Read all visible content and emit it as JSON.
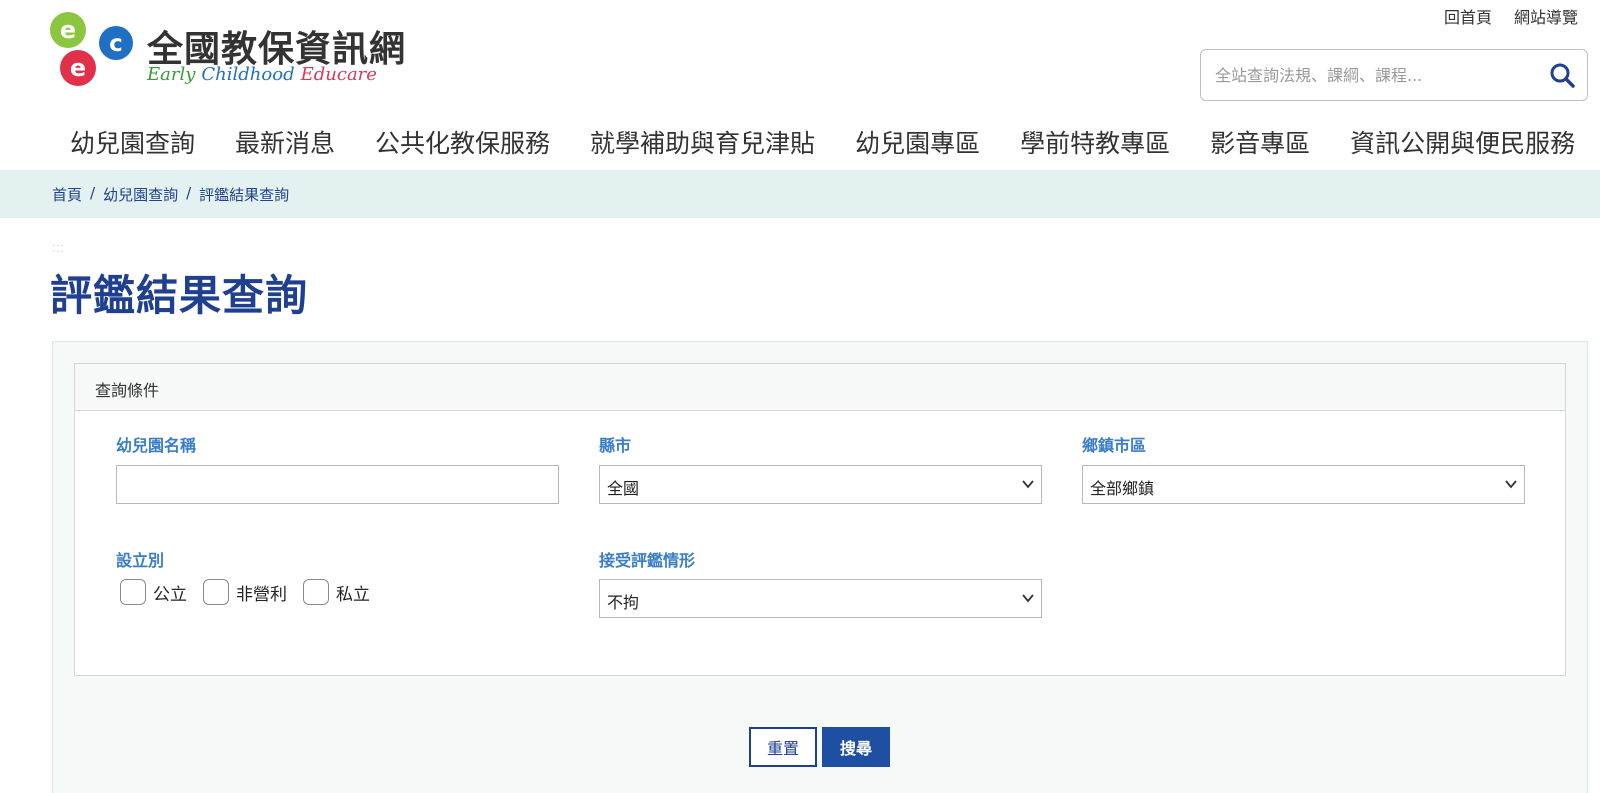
{
  "site": {
    "title": "全國教保資訊網",
    "subtitle_words": [
      "Early",
      "Childhood",
      "Educare"
    ]
  },
  "top_links": [
    "回首頁",
    "網站導覽"
  ],
  "search": {
    "placeholder": "全站查詢法規、課綱、課程..."
  },
  "main_nav": [
    "幼兒園查詢",
    "最新消息",
    "公共化教保服務",
    "就學補助與育兒津貼",
    "幼兒園專區",
    "學前特教專區",
    "影音專區",
    "資訊公開與便民服務"
  ],
  "breadcrumb": {
    "items": [
      "首頁",
      "幼兒園查詢",
      "評鑑結果查詢"
    ],
    "separator": "/"
  },
  "page_title": "評鑑結果查詢",
  "form": {
    "panel_title": "查詢條件",
    "kindergarten_name": {
      "label": "幼兒園名稱",
      "value": ""
    },
    "county": {
      "label": "縣市",
      "value": "全國"
    },
    "township": {
      "label": "鄉鎮市區",
      "value": "全部鄉鎮"
    },
    "establishment": {
      "label": "設立別",
      "options": [
        "公立",
        "非營利",
        "私立"
      ]
    },
    "evaluation_status": {
      "label": "接受評鑑情形",
      "value": "不拘"
    },
    "reset_label": "重置",
    "search_label": "搜尋"
  },
  "colors": {
    "brand_blue": "#1f3f8f",
    "label_blue": "#3a7ec8",
    "breadcrumb_bg": "#e3f2f1",
    "button_blue": "#1f4fa3"
  },
  "icons": {
    "search": "search-icon",
    "chevron": "chevron-down-icon"
  }
}
